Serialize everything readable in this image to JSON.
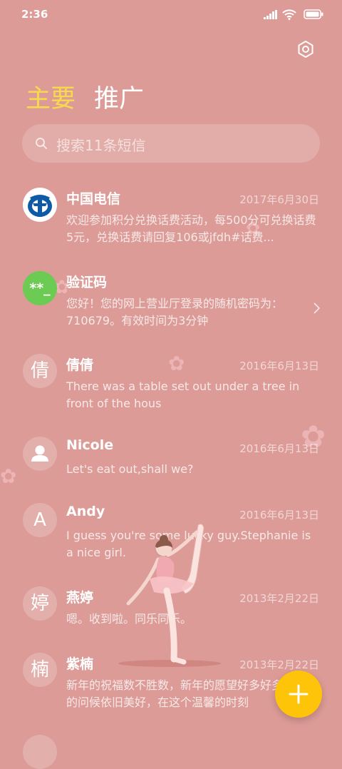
{
  "status_bar": {
    "time": "2:36"
  },
  "tabs": [
    {
      "label": "主要",
      "active": true,
      "color": "#f7d94e"
    },
    {
      "label": "推广",
      "active": false,
      "color": "#ffffff"
    }
  ],
  "search": {
    "placeholder": "搜索11条短信"
  },
  "conversations": [
    {
      "name": "中国电信",
      "date": "2017年6月30日",
      "avatar": "china-telecom-logo",
      "preview": "欢迎参加积分兑换话费活动，每500分可兑换话费5元，兑换话费请回复106或jfdh#话费..."
    },
    {
      "name": "验证码",
      "date": "",
      "avatar_text": "**_",
      "preview": "您好！您的网上营业厅登录的随机密码为：710679。有效时间为3分钟"
    },
    {
      "name": "倩倩",
      "date": "2016年6月13日",
      "avatar_text": "倩",
      "preview": "There was a table set out under a tree in front of the hous"
    },
    {
      "name": "Nicole",
      "date": "2016年6月13日",
      "avatar": "person-icon",
      "preview": "Let's eat out,shall we?"
    },
    {
      "name": "Andy",
      "date": "2016年6月13日",
      "avatar_text": "A",
      "preview": "I guess you're some lucky guy.Stephanie is a nice girl."
    },
    {
      "name": "燕婷",
      "date": "2013年2月22日",
      "avatar_text": "婷",
      "preview": "嗯。收到啦。同乐同乐。"
    },
    {
      "name": "紫楠",
      "date": "2013年2月22日",
      "avatar_text": "楠",
      "preview": "新年的祝福数不胜数，新年的愿望好多好多，新年的问候依旧美好，在这个温馨的时刻"
    }
  ],
  "colors": {
    "background": "#dc9b97",
    "fab": "#fdc40a",
    "verification_avatar": "#6ccb52",
    "telecom_blue": "#0d5aa7"
  }
}
